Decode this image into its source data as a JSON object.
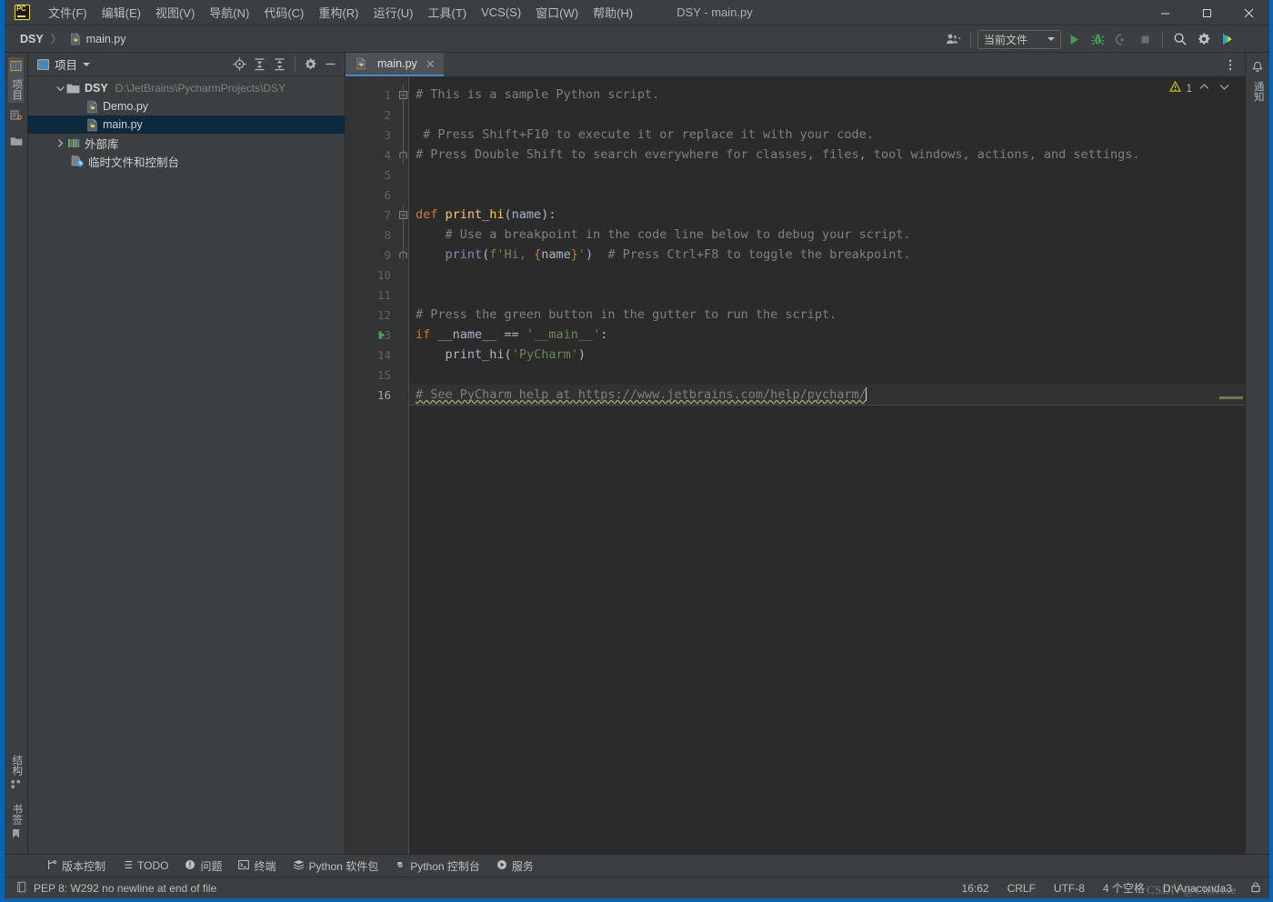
{
  "window": {
    "title": "DSY - main.py",
    "logo_text": "PC",
    "minimize": "─",
    "maximize": "□",
    "close": "✕"
  },
  "menu": {
    "items": [
      {
        "label": "文件(F)",
        "name": "menu-file"
      },
      {
        "label": "编辑(E)",
        "name": "menu-edit"
      },
      {
        "label": "视图(V)",
        "name": "menu-view"
      },
      {
        "label": "导航(N)",
        "name": "menu-navigate"
      },
      {
        "label": "代码(C)",
        "name": "menu-code"
      },
      {
        "label": "重构(R)",
        "name": "menu-refactor"
      },
      {
        "label": "运行(U)",
        "name": "menu-run"
      },
      {
        "label": "工具(T)",
        "name": "menu-tools"
      },
      {
        "label": "VCS(S)",
        "name": "menu-vcs"
      },
      {
        "label": "窗口(W)",
        "name": "menu-window"
      },
      {
        "label": "帮助(H)",
        "name": "menu-help"
      }
    ]
  },
  "navbar": {
    "breadcrumb_project": "DSY",
    "breadcrumb_sep": "〉",
    "breadcrumb_file": "main.py",
    "run_config": "当前文件",
    "icons": {
      "user": "user-icon",
      "run": "run-icon",
      "debug": "debug-icon",
      "run_coverage": "run-with-coverage-icon",
      "stop": "stop-icon",
      "search": "search-icon",
      "settings": "gear-icon",
      "updates": "updates-icon"
    }
  },
  "left_stripe": {
    "top": [
      {
        "label": "项目",
        "name": "stripe-project",
        "icon": "project-icon"
      },
      {
        "label": "",
        "name": "stripe-commit",
        "icon": "commit-icon"
      },
      {
        "label": "",
        "name": "stripe-files",
        "icon": "folder-icon"
      }
    ],
    "bottom": [
      {
        "label": "结构",
        "name": "stripe-structure",
        "icon": "structure-icon"
      },
      {
        "label": "书签",
        "name": "stripe-bookmarks",
        "icon": "bookmark-icon"
      }
    ]
  },
  "right_stripe": {
    "items": [
      {
        "label": "通知",
        "name": "stripe-notifications",
        "icon": "bell-icon"
      }
    ]
  },
  "project_panel": {
    "title": "项目",
    "actions": [
      {
        "name": "select-opened-file-button",
        "icon": "target-icon"
      },
      {
        "name": "expand-all-button",
        "icon": "expand-all-icon"
      },
      {
        "name": "collapse-all-button",
        "icon": "collapse-all-icon"
      },
      {
        "name": "panel-options-button",
        "icon": "gear-icon"
      },
      {
        "name": "hide-panel-button",
        "icon": "minimize-icon"
      }
    ],
    "tree": [
      {
        "label": "DSY",
        "path": "D:\\JetBrains\\PycharmProjects\\DSY",
        "type": "project-root",
        "expanded": true,
        "selected": false,
        "indent": 0
      },
      {
        "label": "Demo.py",
        "path": "",
        "type": "python-file",
        "expanded": false,
        "selected": false,
        "indent": 1
      },
      {
        "label": "main.py",
        "path": "",
        "type": "python-file",
        "expanded": false,
        "selected": true,
        "indent": 1
      },
      {
        "label": "外部库",
        "path": "",
        "type": "external-libraries",
        "expanded": false,
        "selected": false,
        "indent": 0
      },
      {
        "label": "临时文件和控制台",
        "path": "",
        "type": "scratches",
        "expanded": false,
        "selected": false,
        "indent": 0
      }
    ]
  },
  "editor": {
    "tab": {
      "label": "main.py",
      "close": "✕"
    },
    "warning_count": "1",
    "chev_up": "⌃",
    "chev_down": "⌄",
    "lines": [
      {
        "n": "1",
        "fold": "open",
        "run": false
      },
      {
        "n": "2",
        "fold": "",
        "run": false
      },
      {
        "n": "3",
        "fold": "",
        "run": false
      },
      {
        "n": "4",
        "fold": "close",
        "run": false
      },
      {
        "n": "5",
        "fold": "",
        "run": false
      },
      {
        "n": "6",
        "fold": "",
        "run": false
      },
      {
        "n": "7",
        "fold": "open",
        "run": false
      },
      {
        "n": "8",
        "fold": "",
        "run": false
      },
      {
        "n": "9",
        "fold": "close",
        "run": false
      },
      {
        "n": "10",
        "fold": "",
        "run": false
      },
      {
        "n": "11",
        "fold": "",
        "run": false
      },
      {
        "n": "12",
        "fold": "",
        "run": false
      },
      {
        "n": "13",
        "fold": "",
        "run": true
      },
      {
        "n": "14",
        "fold": "",
        "run": false
      },
      {
        "n": "15",
        "fold": "",
        "run": false
      },
      {
        "n": "16",
        "fold": "",
        "run": false
      }
    ],
    "code": {
      "l1": "# This is a sample Python script.",
      "l3": " # Press Shift+F10 to execute it or replace it with your code.",
      "l4": "# Press Double Shift to search everywhere for classes, files, tool windows, actions, and settings.",
      "l7_kw": "def ",
      "l7_fn": "print_hi",
      "l7_rest": "(name):",
      "l8": "    # Use a breakpoint in the code line below to debug your script.",
      "l9_indent": "    ",
      "l9_fn": "print",
      "l9_p1": "(",
      "l9_str1": "f'Hi, ",
      "l9_br1": "{",
      "l9_name": "name",
      "l9_br2": "}",
      "l9_str2": "'",
      "l9_p2": ")",
      "l9_com": "  # Press Ctrl+F8 to toggle the breakpoint.",
      "l12": "# Press the green button in the gutter to run the script.",
      "l13_kw": "if ",
      "l13_name": "__name__ ",
      "l13_op": "== ",
      "l13_str": "'__main__'",
      "l13_colon": ":",
      "l14_indent": "    ",
      "l14_fn": "print_hi",
      "l14_p1": "(",
      "l14_str": "'PyCharm'",
      "l14_p2": ")",
      "l16": "# See PyCharm help at https://www.jetbrains.com/help/pycharm/"
    }
  },
  "toolwindow_bar": {
    "items": [
      {
        "label": "版本控制",
        "name": "toolwindow-version-control",
        "icon": "branch-icon"
      },
      {
        "label": "TODO",
        "name": "toolwindow-todo",
        "icon": "list-icon"
      },
      {
        "label": "问题",
        "name": "toolwindow-problems",
        "icon": "problems-icon"
      },
      {
        "label": "终端",
        "name": "toolwindow-terminal",
        "icon": "terminal-icon"
      },
      {
        "label": "Python 软件包",
        "name": "toolwindow-python-packages",
        "icon": "packages-icon"
      },
      {
        "label": "Python 控制台",
        "name": "toolwindow-python-console",
        "icon": "python-icon"
      },
      {
        "label": "服务",
        "name": "toolwindow-services",
        "icon": "services-icon"
      }
    ]
  },
  "statusbar": {
    "message": "PEP 8: W292 no newline at end of file",
    "caret_position": "16:62",
    "line_separator": "CRLF",
    "encoding": "UTF-8",
    "indent": "4 个空格",
    "interpreter": "D:\\Anaconda3",
    "watermark": "CSDN @Choi1se"
  },
  "colors": {
    "accent_blue": "#0a64b4",
    "panel_bg": "#3c3f41",
    "editor_bg": "#2b2b2b",
    "gutter_bg": "#313335",
    "selection_bg": "#0d293e",
    "tab_underline": "#4a88c7",
    "comment": "#808080",
    "keyword": "#cc7832",
    "string": "#6a8759",
    "function": "#ffc66d",
    "builtin": "#8888c6",
    "warning": "#a3a26e",
    "run_green": "#499c54"
  }
}
